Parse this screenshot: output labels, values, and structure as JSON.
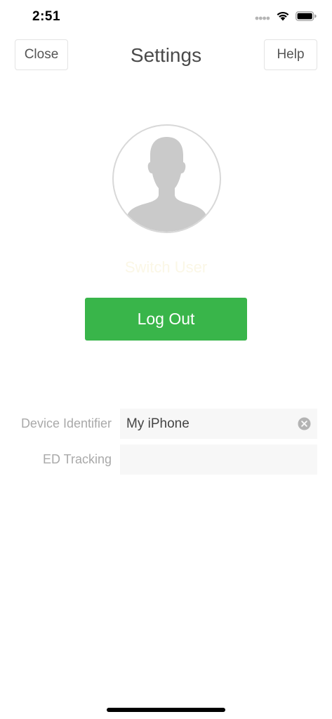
{
  "status_bar": {
    "time": "2:51",
    "icons": [
      "signal-dots-icon",
      "wifi-icon",
      "battery-icon"
    ]
  },
  "nav": {
    "close_label": "Close",
    "title": "Settings",
    "help_label": "Help"
  },
  "profile": {
    "avatar_icon": "person-silhouette-icon",
    "switch_user_label": "Switch User",
    "logout_label": "Log Out"
  },
  "form": {
    "device_identifier": {
      "label": "Device Identifier",
      "value": "My iPhone",
      "clear_icon": "clear-circle-icon"
    },
    "ed_tracking": {
      "label": "ED Tracking",
      "value": ""
    }
  },
  "colors": {
    "accent_green": "#39b54a",
    "switch_user_text": "#fbf7e6",
    "field_background": "#f7f7f7",
    "label_gray": "#a9a9a9"
  }
}
